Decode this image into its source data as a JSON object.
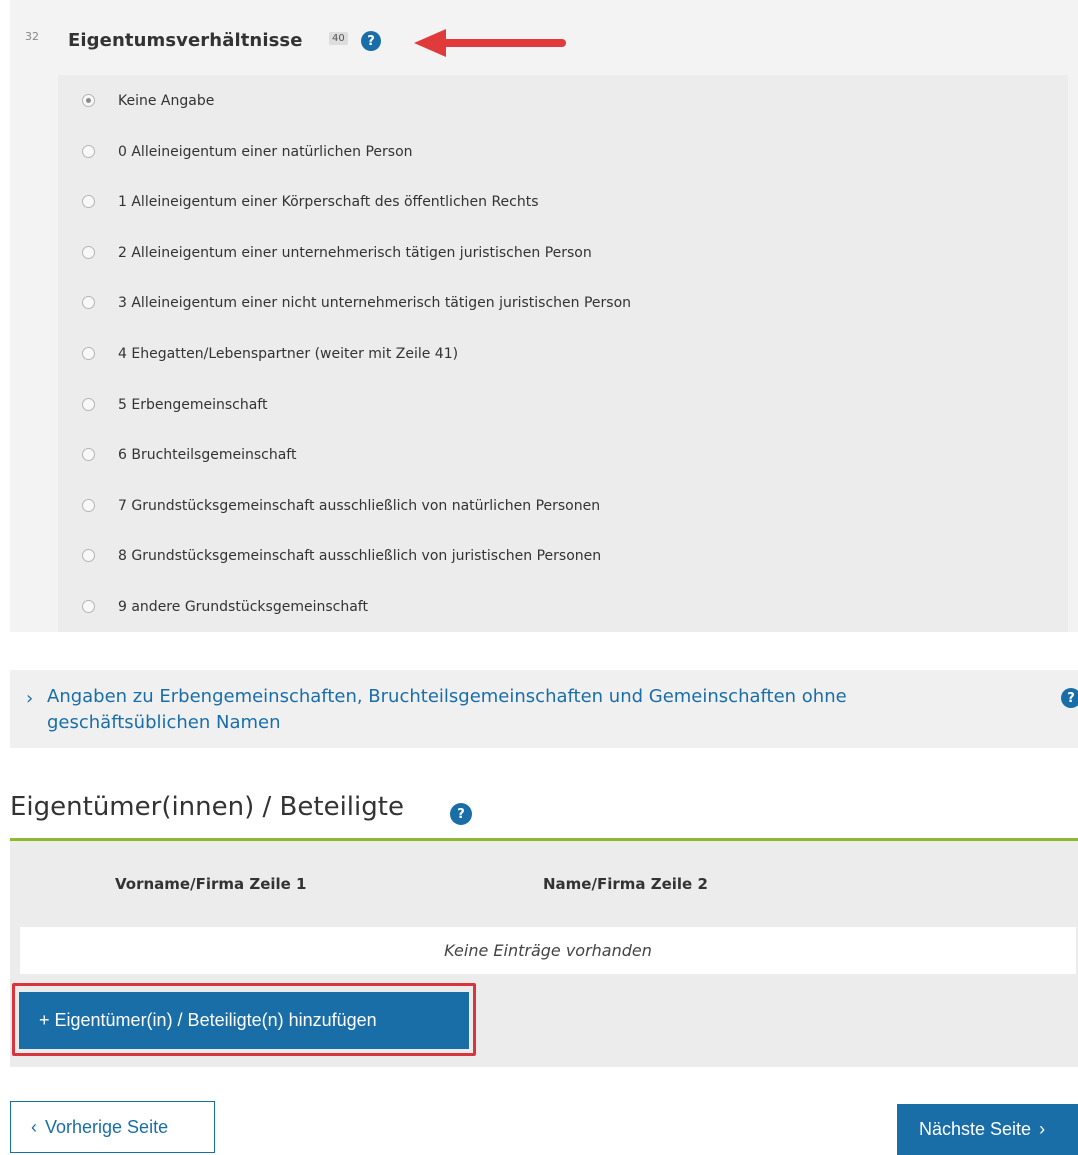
{
  "section": {
    "row_number": "32",
    "title": "Eigentumsverhältnisse",
    "field_ref": "40",
    "help_glyph": "?",
    "options": [
      {
        "label": "Keine Angabe",
        "checked": true
      },
      {
        "label": "0 Alleineigentum einer natürlichen Person",
        "checked": false
      },
      {
        "label": "1 Alleineigentum einer Körperschaft des öffentlichen Rechts",
        "checked": false
      },
      {
        "label": "2 Alleineigentum einer unternehmerisch tätigen juristischen Person",
        "checked": false
      },
      {
        "label": "3 Alleineigentum einer nicht unternehmerisch tätigen juristischen Person",
        "checked": false
      },
      {
        "label": "4 Ehegatten/Lebenspartner (weiter mit Zeile 41)",
        "checked": false
      },
      {
        "label": "5 Erbengemeinschaft",
        "checked": false
      },
      {
        "label": "6 Bruchteilsgemeinschaft",
        "checked": false
      },
      {
        "label": "7 Grundstücksgemeinschaft ausschließlich von natürlichen Personen",
        "checked": false
      },
      {
        "label": "8 Grundstücksgemeinschaft ausschließlich von juristischen Personen",
        "checked": false
      },
      {
        "label": "9 andere Grundstücksgemeinschaft",
        "checked": false
      }
    ]
  },
  "expand": {
    "label": "Angaben zu Erbengemeinschaften, Bruchteilsgemeinschaften und Gemeinschaften ohne geschäftsüblichen Namen",
    "chevron": "›"
  },
  "owners": {
    "title": "Eigentümer(innen) / Beteiligte",
    "columns": [
      "Vorname/Firma Zeile 1",
      "Name/Firma Zeile 2"
    ],
    "empty_text": "Keine Einträge vorhanden",
    "add_label": "+  Eigentümer(in) / Beteiligte(n) hinzufügen"
  },
  "nav": {
    "prev_label": "Vorherige Seite",
    "next_label": "Nächste Seite",
    "prev_chevron": "‹",
    "next_chevron": "›"
  },
  "colors": {
    "accent": "#1a6ea8",
    "highlight_red": "#d7363f",
    "rule_green": "#8dba2f"
  },
  "icons": {
    "help": "help-question-icon",
    "arrow": "red-arrow-annotation-icon"
  }
}
